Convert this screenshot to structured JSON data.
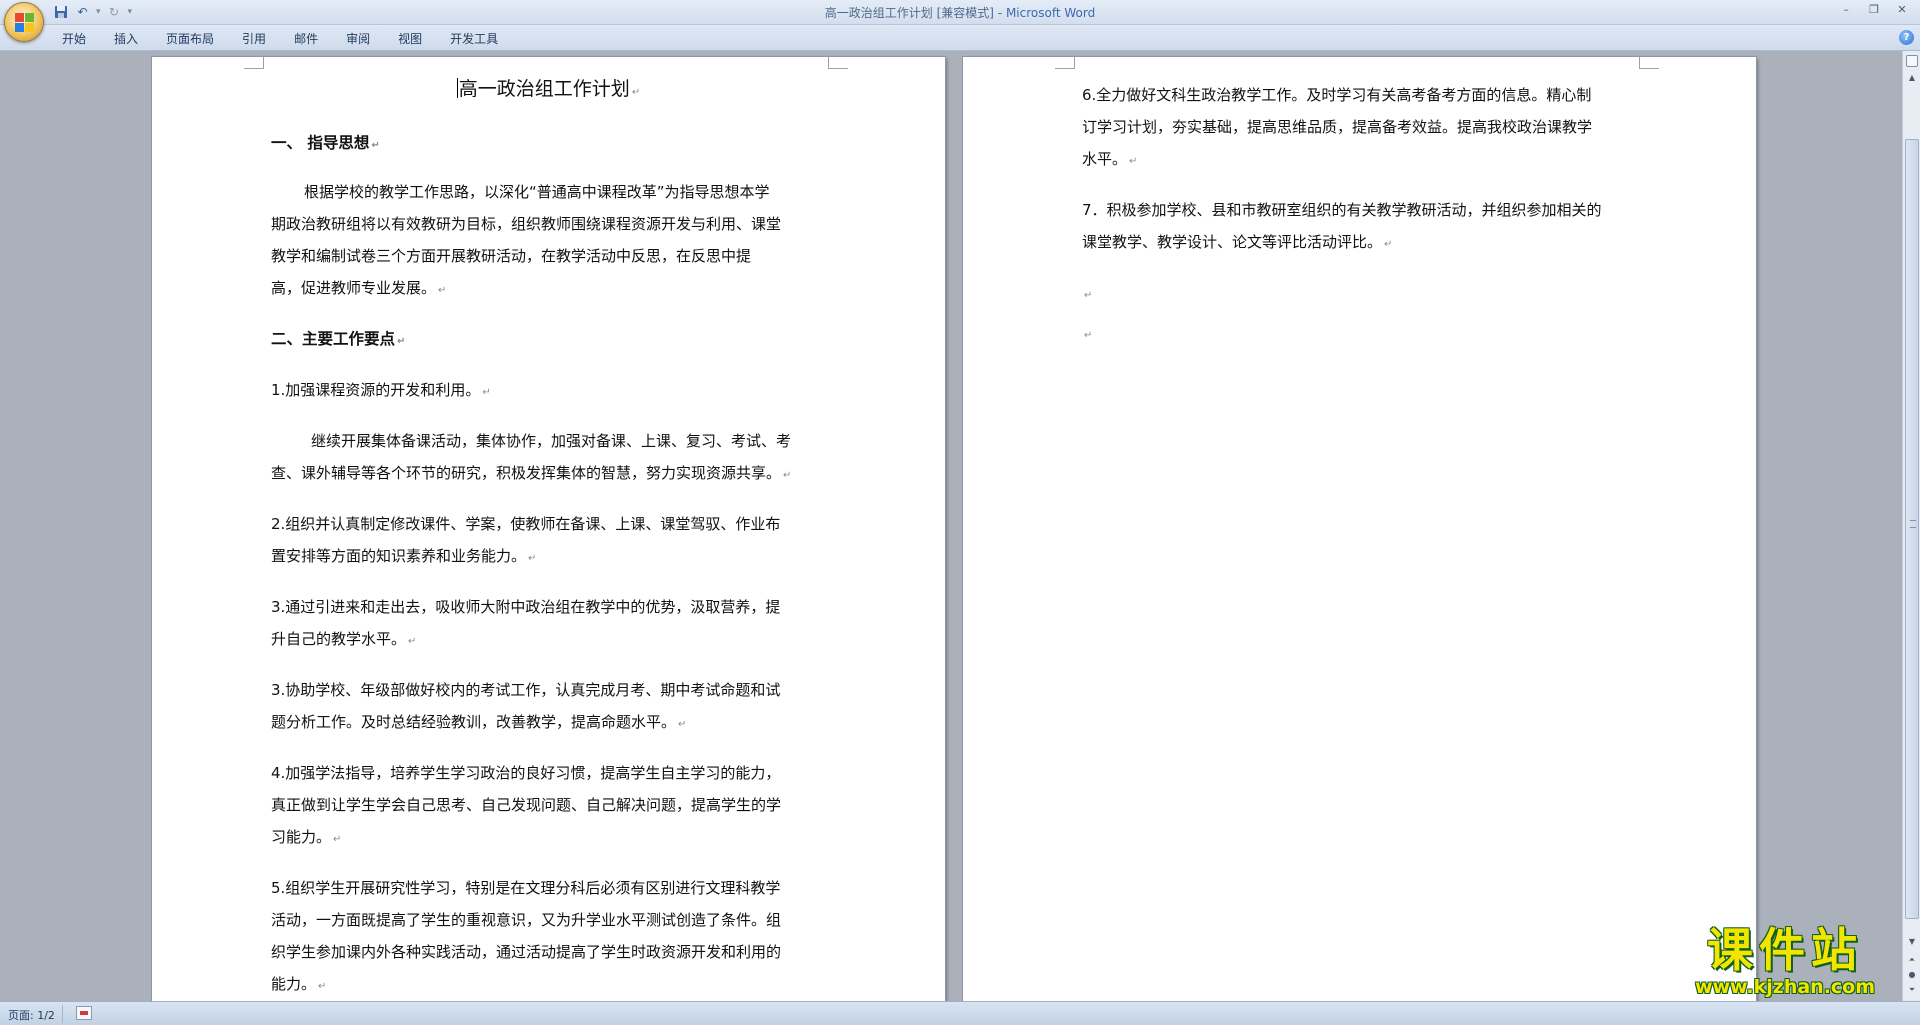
{
  "window": {
    "doc_title": "高一政治组工作计划 [兼容模式]",
    "separator": " - ",
    "app_name": "Microsoft Word"
  },
  "ribbon": {
    "tabs": [
      "开始",
      "插入",
      "页面布局",
      "引用",
      "邮件",
      "审阅",
      "视图",
      "开发工具"
    ]
  },
  "document": {
    "page1": {
      "title": "高一政治组工作计划",
      "heading1": "一、 指导思想",
      "guiding_para_lines": [
        "根据学校的教学工作思路，以深化“普通高中课程改革”为指导思想本学",
        "期政治教研组将以有效教研为目标，组织教师围绕课程资源开发与利用、课堂",
        "教学和编制试卷三个方面开展教研活动，在教学活动中反思，在反思中提",
        "高，促进教师专业发展。"
      ],
      "heading2": "二、主要工作要点",
      "item1": "1.加强课程资源的开发和利用。",
      "item1_detail_lines": [
        "继续开展集体备课活动，集体协作，加强对备课、上课、复习、考试、考",
        "查、课外辅导等各个环节的研究，积极发挥集体的智慧，努力实现资源共享。"
      ],
      "item2_lines": [
        "2.组织并认真制定修改课件、学案，使教师在备课、上课、课堂驾驭、作业布",
        "置安排等方面的知识素养和业务能力。"
      ],
      "item3a_lines": [
        "3.通过引进来和走出去，吸收师大附中政治组在教学中的优势，汲取营养，提",
        "升自己的教学水平。"
      ],
      "item3b_lines": [
        "3.协助学校、年级部做好校内的考试工作，认真完成月考、期中考试命题和试",
        "题分析工作。及时总结经验教训，改善教学，提高命题水平。"
      ],
      "item4_lines": [
        "4.加强学法指导，培养学生学习政治的良好习惯，提高学生自主学习的能力，",
        "真正做到让学生学会自己思考、自己发现问题、自己解决问题，提高学生的学",
        "习能力。"
      ],
      "item5_lines": [
        "5.组织学生开展研究性学习，特别是在文理分科后必须有区别进行文理科教学",
        "活动，一方面既提高了学生的重视意识，又为升学业水平测试创造了条件。组",
        "织学生参加课内外各种实践活动，通过活动提高了学生时政资源开发和利用的",
        "能力。"
      ]
    },
    "page2": {
      "item6_lines": [
        "6.全力做好文科生政治教学工作。及时学习有关高考备考方面的信息。精心制",
        "订学习计划，夯实基础，提高思维品质，提高备考效益。提高我校政治课教学",
        "水平。"
      ],
      "item7_lines": [
        "7．积极参加学校、县和市教研室组织的有关教学教研活动，并组织参加相关的",
        "课堂教学、教学设计、论文等评比活动评比。"
      ],
      "return_mark": "↵"
    }
  },
  "status": {
    "page_indicator": "页面: 1/2"
  },
  "watermark": {
    "main": "课件站",
    "url": "www.kjzhan.com"
  },
  "colors": {
    "accent": "#3a6bb1",
    "workspace": "#abb1bb"
  }
}
